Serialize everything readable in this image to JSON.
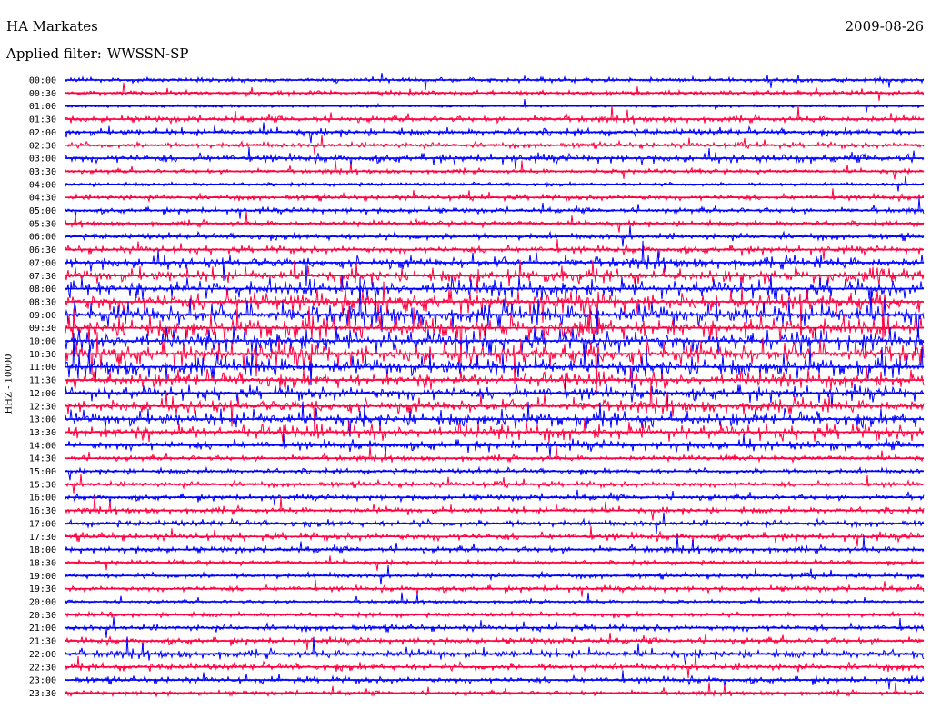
{
  "header": {
    "station": "HA Markates",
    "date": "2009-08-26",
    "filter_label": "Applied filter:",
    "filter_value": "WWSSN-SP",
    "channel": "HHZ - 10000"
  },
  "colors": {
    "trace_a": "#0000ff",
    "trace_b": "#ff0040",
    "text": "#000000"
  },
  "chart_data": {
    "type": "line",
    "title": "HA Markates",
    "subtitle": "Applied filter: WWSSN-SP",
    "ylabel": "HHZ - 10000",
    "row_labels": [
      "00:00",
      "00:30",
      "01:00",
      "01:30",
      "02:00",
      "02:30",
      "03:00",
      "03:30",
      "04:00",
      "04:30",
      "05:00",
      "05:30",
      "06:00",
      "06:30",
      "07:00",
      "07:30",
      "08:00",
      "08:30",
      "09:00",
      "09:30",
      "10:00",
      "10:30",
      "11:00",
      "11:30",
      "12:00",
      "12:30",
      "13:00",
      "13:30",
      "14:00",
      "14:30",
      "15:00",
      "15:30",
      "16:00",
      "16:30",
      "17:00",
      "17:30",
      "18:00",
      "18:30",
      "19:00",
      "19:30",
      "20:00",
      "20:30",
      "21:00",
      "21:30",
      "22:00",
      "22:30",
      "23:00",
      "23:30"
    ],
    "row_activity": [
      0.15,
      0.15,
      0.05,
      0.25,
      0.3,
      0.2,
      0.35,
      0.15,
      0.1,
      0.2,
      0.2,
      0.2,
      0.25,
      0.3,
      0.5,
      0.6,
      0.8,
      0.9,
      1.0,
      1.0,
      1.0,
      1.0,
      0.9,
      0.7,
      0.6,
      0.6,
      0.7,
      0.7,
      0.4,
      0.2,
      0.2,
      0.2,
      0.2,
      0.25,
      0.25,
      0.3,
      0.25,
      0.15,
      0.2,
      0.2,
      0.1,
      0.15,
      0.25,
      0.25,
      0.35,
      0.3,
      0.25,
      0.15
    ],
    "color_alternation": [
      "blue",
      "red"
    ]
  }
}
